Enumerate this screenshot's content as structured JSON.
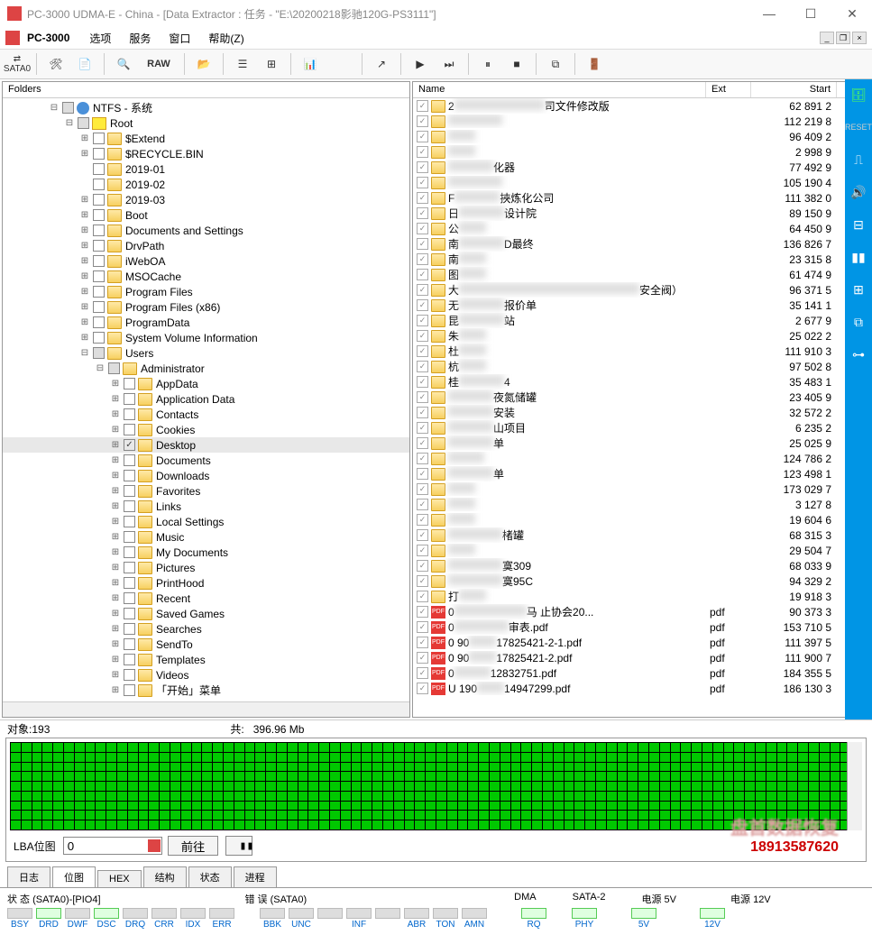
{
  "window": {
    "title": "PC-3000 UDMA-E - China - [Data Extractor : 任务 - \"E:\\20200218影驰120G-PS3111\"]"
  },
  "menu": {
    "label": "PC-3000",
    "items": [
      "选项",
      "服务",
      "窗口",
      "帮助(Z)"
    ]
  },
  "toolbar": {
    "sata": "SATA0",
    "raw": "RAW"
  },
  "leftpanel": {
    "header": "Folders"
  },
  "tree": [
    {
      "depth": 3,
      "exp": "-",
      "cbx": "g",
      "ico": "disk",
      "label": "NTFS - 系统"
    },
    {
      "depth": 4,
      "exp": "-",
      "cbx": "g",
      "ico": "root",
      "label": "Root"
    },
    {
      "depth": 5,
      "exp": "+",
      "cbx": "",
      "ico": "folder",
      "label": "$Extend"
    },
    {
      "depth": 5,
      "exp": "+",
      "cbx": "",
      "ico": "folder",
      "label": "$RECYCLE.BIN"
    },
    {
      "depth": 5,
      "exp": "",
      "cbx": "",
      "ico": "folder",
      "label": "2019-01"
    },
    {
      "depth": 5,
      "exp": "",
      "cbx": "",
      "ico": "folder",
      "label": "2019-02"
    },
    {
      "depth": 5,
      "exp": "+",
      "cbx": "",
      "ico": "folder",
      "label": "2019-03"
    },
    {
      "depth": 5,
      "exp": "+",
      "cbx": "",
      "ico": "folder",
      "label": "Boot"
    },
    {
      "depth": 5,
      "exp": "+",
      "cbx": "",
      "ico": "folder",
      "label": "Documents and Settings"
    },
    {
      "depth": 5,
      "exp": "+",
      "cbx": "",
      "ico": "folder",
      "label": "DrvPath"
    },
    {
      "depth": 5,
      "exp": "+",
      "cbx": "",
      "ico": "folder",
      "label": "iWebOA"
    },
    {
      "depth": 5,
      "exp": "+",
      "cbx": "",
      "ico": "folder",
      "label": "MSOCache"
    },
    {
      "depth": 5,
      "exp": "+",
      "cbx": "",
      "ico": "folder",
      "label": "Program Files"
    },
    {
      "depth": 5,
      "exp": "+",
      "cbx": "",
      "ico": "folder",
      "label": "Program Files (x86)"
    },
    {
      "depth": 5,
      "exp": "+",
      "cbx": "",
      "ico": "folder",
      "label": "ProgramData"
    },
    {
      "depth": 5,
      "exp": "+",
      "cbx": "",
      "ico": "folder",
      "label": "System Volume Information"
    },
    {
      "depth": 5,
      "exp": "-",
      "cbx": "g",
      "ico": "folder",
      "label": "Users"
    },
    {
      "depth": 6,
      "exp": "-",
      "cbx": "g",
      "ico": "folder",
      "label": "Administrator"
    },
    {
      "depth": 7,
      "exp": "+",
      "cbx": "",
      "ico": "folder",
      "label": "AppData"
    },
    {
      "depth": 7,
      "exp": "+",
      "cbx": "",
      "ico": "folder",
      "label": "Application Data"
    },
    {
      "depth": 7,
      "exp": "+",
      "cbx": "",
      "ico": "folder",
      "label": "Contacts"
    },
    {
      "depth": 7,
      "exp": "+",
      "cbx": "",
      "ico": "folder",
      "label": "Cookies"
    },
    {
      "depth": 7,
      "exp": "+",
      "cbx": "c",
      "ico": "folder",
      "label": "Desktop",
      "sel": true
    },
    {
      "depth": 7,
      "exp": "+",
      "cbx": "",
      "ico": "folder",
      "label": "Documents"
    },
    {
      "depth": 7,
      "exp": "+",
      "cbx": "",
      "ico": "folder",
      "label": "Downloads"
    },
    {
      "depth": 7,
      "exp": "+",
      "cbx": "",
      "ico": "folder",
      "label": "Favorites"
    },
    {
      "depth": 7,
      "exp": "+",
      "cbx": "",
      "ico": "folder",
      "label": "Links"
    },
    {
      "depth": 7,
      "exp": "+",
      "cbx": "",
      "ico": "folder",
      "label": "Local Settings"
    },
    {
      "depth": 7,
      "exp": "+",
      "cbx": "",
      "ico": "folder",
      "label": "Music"
    },
    {
      "depth": 7,
      "exp": "+",
      "cbx": "",
      "ico": "folder",
      "label": "My Documents"
    },
    {
      "depth": 7,
      "exp": "+",
      "cbx": "",
      "ico": "folder",
      "label": "Pictures"
    },
    {
      "depth": 7,
      "exp": "+",
      "cbx": "",
      "ico": "folder",
      "label": "PrintHood"
    },
    {
      "depth": 7,
      "exp": "+",
      "cbx": "",
      "ico": "folder",
      "label": "Recent"
    },
    {
      "depth": 7,
      "exp": "+",
      "cbx": "",
      "ico": "folder",
      "label": "Saved Games"
    },
    {
      "depth": 7,
      "exp": "+",
      "cbx": "",
      "ico": "folder",
      "label": "Searches"
    },
    {
      "depth": 7,
      "exp": "+",
      "cbx": "",
      "ico": "folder",
      "label": "SendTo"
    },
    {
      "depth": 7,
      "exp": "+",
      "cbx": "",
      "ico": "folder",
      "label": "Templates"
    },
    {
      "depth": 7,
      "exp": "+",
      "cbx": "",
      "ico": "folder",
      "label": "Videos"
    },
    {
      "depth": 7,
      "exp": "+",
      "cbx": "",
      "ico": "folder",
      "label": "「开始」菜单"
    }
  ],
  "listcols": {
    "name": "Name",
    "ext": "Ext",
    "start": "Start"
  },
  "files": [
    {
      "ico": "folder",
      "name": "2",
      "blur": 100,
      "suffix": "司文件修改版",
      "ext": "",
      "start": "62 891 2"
    },
    {
      "ico": "folder",
      "name": "",
      "blur": 60,
      "suffix": "",
      "ext": "",
      "start": "112 219 8"
    },
    {
      "ico": "folder",
      "name": "",
      "blur": 30,
      "suffix": "",
      "ext": "",
      "start": "96 409 2"
    },
    {
      "ico": "folder",
      "name": "",
      "blur": 30,
      "suffix": "",
      "ext": "",
      "start": "2 998 9"
    },
    {
      "ico": "folder",
      "name": "",
      "blur": 50,
      "suffix": "化器",
      "ext": "",
      "start": "77 492 9"
    },
    {
      "ico": "folder",
      "name": "",
      "blur": 60,
      "suffix": "",
      "ext": "",
      "start": "105 190 4"
    },
    {
      "ico": "folder",
      "name": "F",
      "blur": 50,
      "suffix": "挾炼化公司",
      "ext": "",
      "start": "111 382 0"
    },
    {
      "ico": "folder",
      "name": "日",
      "blur": 50,
      "suffix": "设计院",
      "ext": "",
      "start": "89 150 9"
    },
    {
      "ico": "folder",
      "name": "公",
      "blur": 30,
      "suffix": "",
      "ext": "",
      "start": "64 450 9"
    },
    {
      "ico": "folder",
      "name": "南",
      "blur": 50,
      "suffix": "D最终",
      "ext": "",
      "start": "136 826 7"
    },
    {
      "ico": "folder",
      "name": "南",
      "blur": 30,
      "suffix": "",
      "ext": "",
      "start": "23 315 8"
    },
    {
      "ico": "folder",
      "name": "图",
      "blur": 30,
      "suffix": "",
      "ext": "",
      "start": "61 474 9"
    },
    {
      "ico": "folder",
      "name": "大",
      "blur": 200,
      "suffix": "安全阀）",
      "ext": "",
      "start": "96 371 5"
    },
    {
      "ico": "folder",
      "name": "无",
      "blur": 50,
      "suffix": "报价单",
      "ext": "",
      "start": "35 141 1"
    },
    {
      "ico": "folder",
      "name": "昆",
      "blur": 50,
      "suffix": "站",
      "ext": "",
      "start": "2 677 9"
    },
    {
      "ico": "folder",
      "name": "朱",
      "blur": 30,
      "suffix": "",
      "ext": "",
      "start": "25 022 2"
    },
    {
      "ico": "folder",
      "name": "杜",
      "blur": 30,
      "suffix": "",
      "ext": "",
      "start": "111 910 3"
    },
    {
      "ico": "folder",
      "name": "杭",
      "blur": 30,
      "suffix": "",
      "ext": "",
      "start": "97 502 8"
    },
    {
      "ico": "folder",
      "name": "桂",
      "blur": 50,
      "suffix": "4",
      "ext": "",
      "start": "35 483 1"
    },
    {
      "ico": "folder",
      "name": "",
      "blur": 50,
      "suffix": "夜氮储罐",
      "ext": "",
      "start": "23 405 9"
    },
    {
      "ico": "folder",
      "name": "",
      "blur": 50,
      "suffix": "安装",
      "ext": "",
      "start": "32 572 2"
    },
    {
      "ico": "folder",
      "name": "",
      "blur": 50,
      "suffix": "山项目",
      "ext": "",
      "start": "6 235 2"
    },
    {
      "ico": "folder",
      "name": "",
      "blur": 50,
      "suffix": "单",
      "ext": "",
      "start": "25 025 9"
    },
    {
      "ico": "folder",
      "name": "",
      "blur": 40,
      "suffix": "",
      "ext": "",
      "start": "124 786 2"
    },
    {
      "ico": "folder",
      "name": "",
      "blur": 50,
      "suffix": "单",
      "ext": "",
      "start": "123 498 1"
    },
    {
      "ico": "folder",
      "name": "",
      "blur": 30,
      "suffix": "",
      "ext": "",
      "start": "173 029 7"
    },
    {
      "ico": "folder",
      "name": "",
      "blur": 30,
      "suffix": "",
      "ext": "",
      "start": "3 127 8"
    },
    {
      "ico": "folder",
      "name": "",
      "blur": 30,
      "suffix": "",
      "ext": "",
      "start": "19 604 6"
    },
    {
      "ico": "folder",
      "name": "",
      "blur": 60,
      "suffix": "楮罐",
      "ext": "",
      "start": "68 315 3"
    },
    {
      "ico": "folder",
      "name": "",
      "blur": 30,
      "suffix": "",
      "ext": "",
      "start": "29 504 7"
    },
    {
      "ico": "folder",
      "name": "",
      "blur": 60,
      "suffix": "寞309",
      "ext": "",
      "start": "68 033 9"
    },
    {
      "ico": "folder",
      "name": "",
      "blur": 60,
      "suffix": "寞95C",
      "ext": "",
      "start": "94 329 2"
    },
    {
      "ico": "folder",
      "name": "打",
      "blur": 30,
      "suffix": "",
      "ext": "",
      "start": "19 918 3"
    },
    {
      "ico": "pdf",
      "name": "0",
      "blur": 80,
      "suffix": "马         止协会20...",
      "ext": "pdf",
      "start": "90 373 3"
    },
    {
      "ico": "pdf",
      "name": "0",
      "blur": 60,
      "suffix": "审表.pdf",
      "ext": "pdf",
      "start": "153 710 5"
    },
    {
      "ico": "pdf",
      "name": "0    90",
      "blur": 30,
      "suffix": "17825421-2-1.pdf",
      "ext": "pdf",
      "start": "111 397 5"
    },
    {
      "ico": "pdf",
      "name": "0    90",
      "blur": 30,
      "suffix": "17825421-2.pdf",
      "ext": "pdf",
      "start": "111 900 7"
    },
    {
      "ico": "pdf",
      "name": "0",
      "blur": 40,
      "suffix": "12832751.pdf",
      "ext": "pdf",
      "start": "184 355 5"
    },
    {
      "ico": "pdf",
      "name": "U    190",
      "blur": 30,
      "suffix": "14947299.pdf",
      "ext": "pdf",
      "start": "186 130 3"
    }
  ],
  "status": {
    "objects_label": "对象:",
    "objects": "193",
    "total_label": "共:",
    "total": "396.96 Mb"
  },
  "lba": {
    "label": "LBA位图",
    "value": "0",
    "go": "前往"
  },
  "watermark": {
    "line1": "盘首数据恢复",
    "line2": "18913587620"
  },
  "tabs": [
    "日志",
    "位图",
    "HEX",
    "结构",
    "状态",
    "进程"
  ],
  "active_tab": 1,
  "bottom": {
    "status_label": "状 态 (SATA0)-[PIO4]",
    "error_label": "错 误 (SATA0)",
    "dma_label": "DMA",
    "sata_label": "SATA-2",
    "pwr5_label": "电源 5V",
    "pwr12_label": "电源 12V",
    "status_leds": [
      "BSY",
      "DRD",
      "DWF",
      "DSC",
      "DRQ",
      "CRR",
      "IDX",
      "ERR"
    ],
    "status_on": [
      false,
      true,
      false,
      true,
      false,
      false,
      false,
      false
    ],
    "error_leds": [
      "BBK",
      "UNC",
      "",
      "INF",
      "",
      "ABR",
      "TON",
      "AMN"
    ],
    "dma": "RQ",
    "sata": "PHY",
    "v5": "5V",
    "v12": "12V"
  }
}
